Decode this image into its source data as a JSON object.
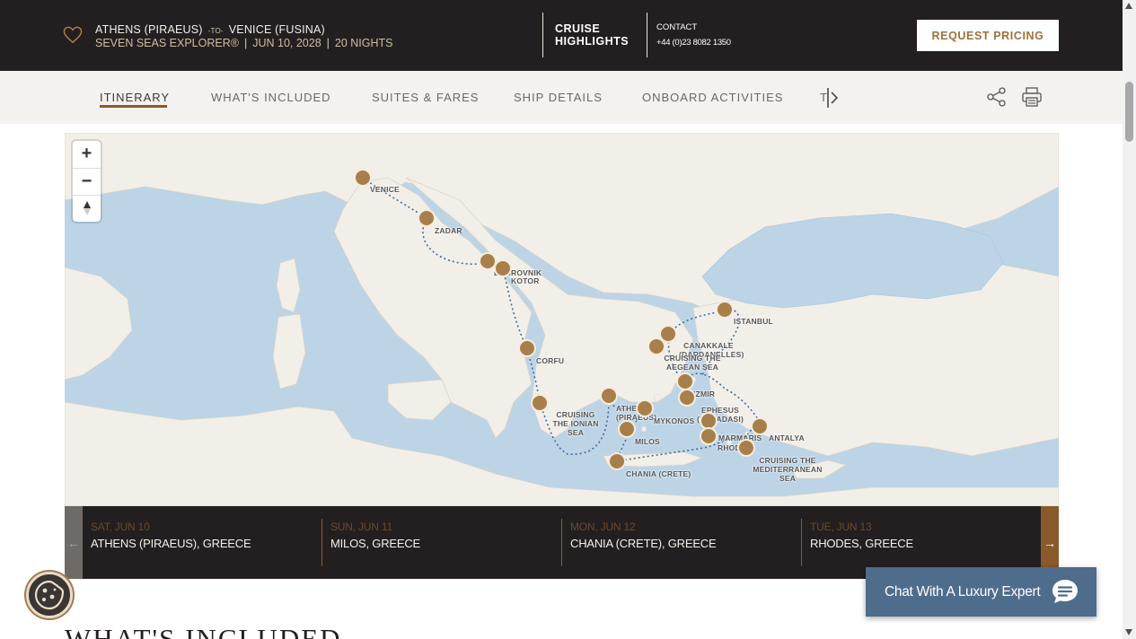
{
  "header": {
    "origin": "ATHENS (PIRAEUS)",
    "to_label": "-TO-",
    "destination": "VENICE (FUSINA)",
    "ship": "SEVEN SEAS EXPLORER®",
    "date": "JUN 10, 2028",
    "nights": "20 NIGHTS",
    "separator": "|",
    "highlights_line1": "CRUISE",
    "highlights_line2": "HIGHLIGHTS",
    "contact_label": "CONTACT",
    "contact_phone": "+44 (0)23 8082 1350",
    "request_button": "REQUEST PRICING",
    "favorite_icon": "heart-outline-icon"
  },
  "nav": {
    "tabs": [
      {
        "label": "ITINERARY",
        "active": true
      },
      {
        "label": "WHAT'S INCLUDED",
        "active": false
      },
      {
        "label": "SUITES & FARES",
        "active": false
      },
      {
        "label": "SHIP DETAILS",
        "active": false
      },
      {
        "label": "ONBOARD ACTIVITIES",
        "active": false
      }
    ],
    "overflow_tab": "T",
    "icons": [
      "chevron-right-icon",
      "share-icon",
      "printer-icon"
    ]
  },
  "map": {
    "zoom_in": "+",
    "zoom_out": "−",
    "compass": "▲",
    "ports": [
      {
        "name": "VENICE"
      },
      {
        "name": "ZADAR"
      },
      {
        "name": "DUBROVNIK"
      },
      {
        "name": "KOTOR"
      },
      {
        "name": "CORFU"
      },
      {
        "name": "CRUISING THE IONIAN SEA"
      },
      {
        "name": "ATHENS (PIRAEUS)"
      },
      {
        "name": "MILOS"
      },
      {
        "name": "CHANIA (CRETE)"
      },
      {
        "name": "MYKONOS"
      },
      {
        "name": "EPHESUS (KUSADASI)"
      },
      {
        "name": "IZMIR"
      },
      {
        "name": "CANAKKALE (DARDANELLES)"
      },
      {
        "name": "CRUISING THE AEGEAN SEA"
      },
      {
        "name": "ISTANBUL"
      },
      {
        "name": "MARMARIS"
      },
      {
        "name": "RHODES"
      },
      {
        "name": "ANTALYA"
      },
      {
        "name": "CRUISING THE MEDITERRANEAN SEA"
      }
    ],
    "colors": {
      "sea": "#bcd4e6",
      "land": "#f2efe9",
      "route": "#3a6e9c",
      "port": "#a87f4a"
    }
  },
  "itinerary_days": [
    {
      "date": "SAT, JUN 10",
      "port": "ATHENS (PIRAEUS), GREECE"
    },
    {
      "date": "SUN, JUN 11",
      "port": "MILOS, GREECE"
    },
    {
      "date": "MON, JUN 12",
      "port": "CHANIA (CRETE), GREECE"
    },
    {
      "date": "TUE, JUN 13",
      "port": "RHODES, GREECE"
    }
  ],
  "day_nav": {
    "prev": "←",
    "next": "→"
  },
  "section_heading": "WHAT'S INCLUDED",
  "chat": {
    "label": "Chat With A Luxury Expert",
    "icon": "chat-bubble-icon"
  },
  "cookie": {
    "icon": "cookie-icon"
  },
  "colors": {
    "dark": "#231f20",
    "accent": "#8a5a2b",
    "nav_bg": "#f4f2ee",
    "chat": "#4e6d8c"
  }
}
